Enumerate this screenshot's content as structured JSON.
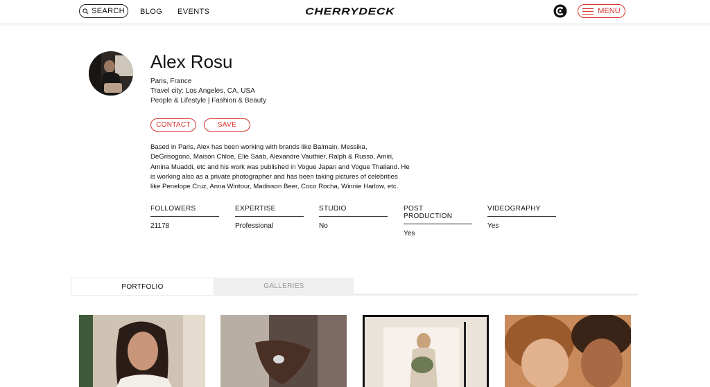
{
  "header": {
    "search_label": "SEARCH",
    "nav": [
      "BLOG",
      "EVENTS"
    ],
    "logo": "CHERRYDECK",
    "menu_label": "MENU"
  },
  "profile": {
    "name": "Alex Rosu",
    "location": "Paris, France",
    "travel_city": "Travel city: Los Angeles, CA, USA",
    "categories": "People & Lifestyle | Fashion & Beauty",
    "contact_label": "CONTACT",
    "save_label": "SAVE",
    "bio_lines": [
      "Based in Paris, Alex has been working with brands like Balmain,  Messika,",
      "DeGrisogono, Maison Chloe,  Elie Saab, Alexandre Vauthier, Ralph & Russo, Amiri,",
      "Amina Muaddi, etc and his work was published in Vogue Japan and Vogue Thailand.  He",
      "is working  also as a private photographer and has been taking pictures of celebrities",
      "like Penelope Cruz, Anna Wintour, Madisson Beer,  Coco Rocha, Winnie Harlow,  etc."
    ]
  },
  "stats": [
    {
      "label": "FOLLOWERS",
      "value": "21178"
    },
    {
      "label": "EXPERTISE",
      "value": "Professional"
    },
    {
      "label": "STUDIO",
      "value": "No"
    },
    {
      "label": "POST PRODUCTION",
      "value": "Yes"
    },
    {
      "label": "VIDEOGRAPHY",
      "value": "Yes"
    }
  ],
  "tabs": [
    {
      "label": "PORTFOLIO",
      "active": true
    },
    {
      "label": "GALLERIES",
      "active": false
    }
  ],
  "colors": {
    "accent": "#d9302c",
    "tab_inactive_bg": "#efefef",
    "tab_inactive_text": "#999999"
  },
  "icons": [
    "search-icon",
    "brand-c-icon",
    "hamburger-icon"
  ]
}
